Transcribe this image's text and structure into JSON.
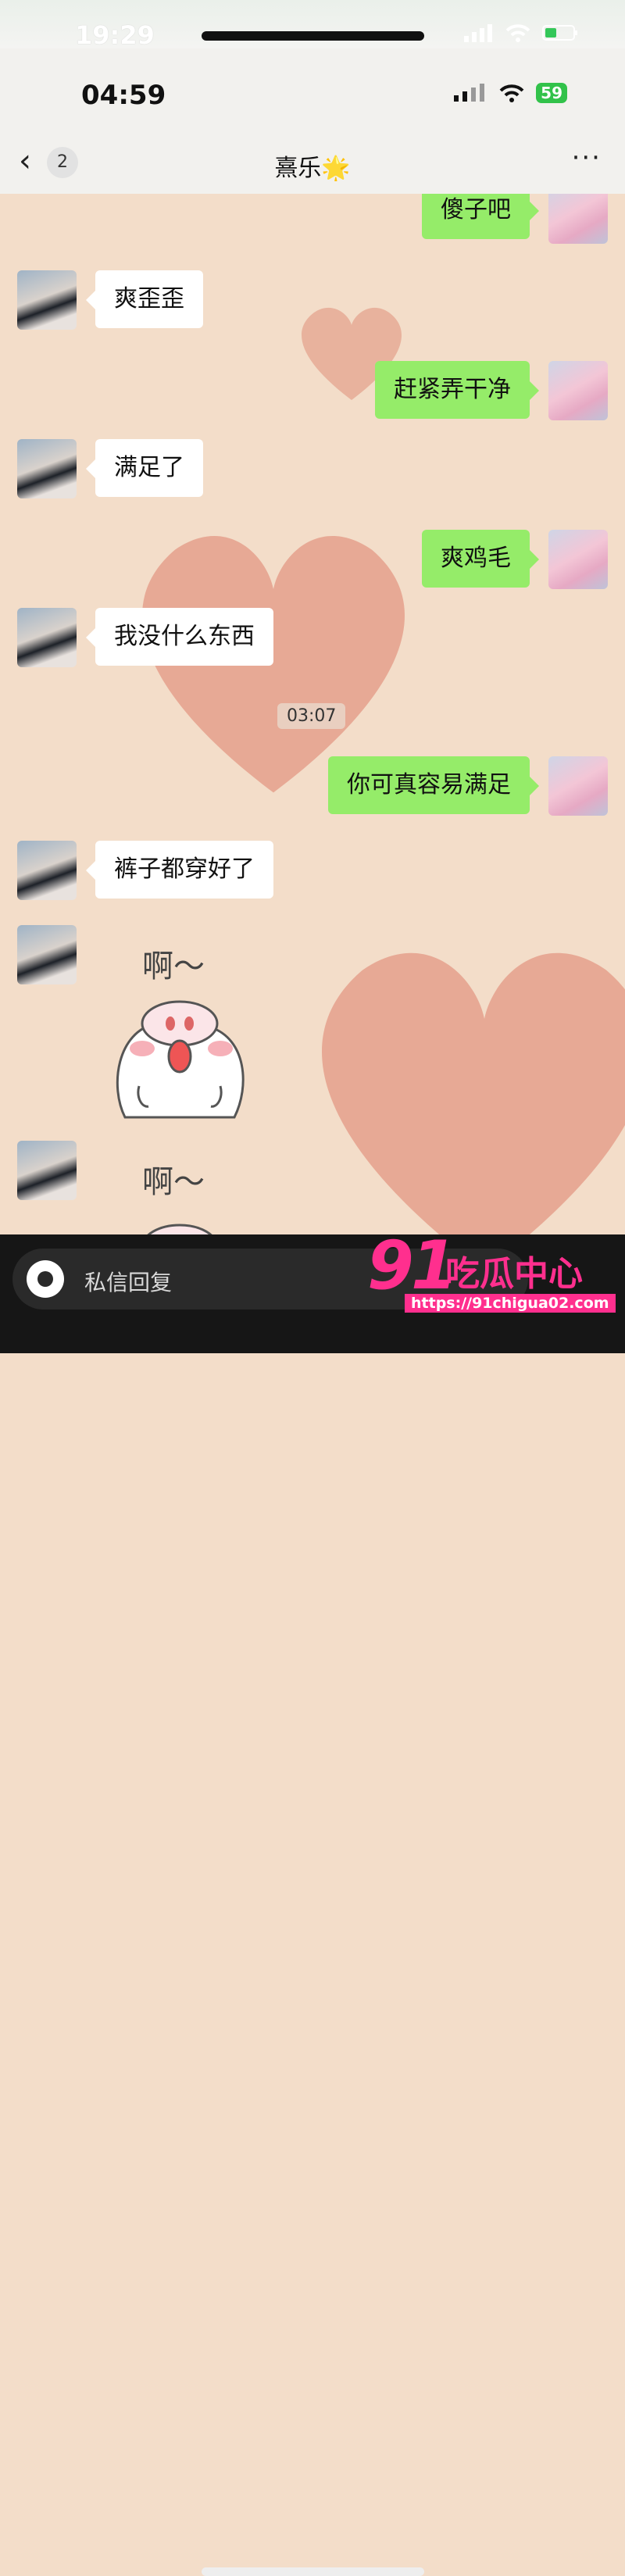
{
  "outer_status": {
    "time": "19:29"
  },
  "status": {
    "time": "04:59",
    "battery": "59"
  },
  "nav": {
    "back_icon": "‹",
    "unread": "2",
    "title": "熹乐🌟",
    "more": "···"
  },
  "timestamp": "03:07",
  "messages": [
    {
      "side": "right",
      "text": "傻子吧"
    },
    {
      "side": "left",
      "text": "爽歪歪"
    },
    {
      "side": "right",
      "text": "赶紧弄干净"
    },
    {
      "side": "left",
      "text": "满足了"
    },
    {
      "side": "right",
      "text": "爽鸡毛"
    },
    {
      "side": "left",
      "text": "我没什么东西"
    },
    {
      "side": "right",
      "text": "你可真容易满足"
    },
    {
      "side": "left",
      "text": "裤子都穿好了"
    }
  ],
  "stickers": [
    {
      "text": "啊～"
    },
    {
      "text": "啊～"
    }
  ],
  "input": {
    "placeholder": "私信回复"
  },
  "watermark": {
    "number": "91",
    "name": "吃瓜中心",
    "url": "https://91chigua02.com"
  },
  "colors": {
    "self_bubble": "#95ec69",
    "other_bubble": "#ffffff",
    "chat_bg": "#f3ddc9",
    "watermark": "#ff2f8e"
  }
}
